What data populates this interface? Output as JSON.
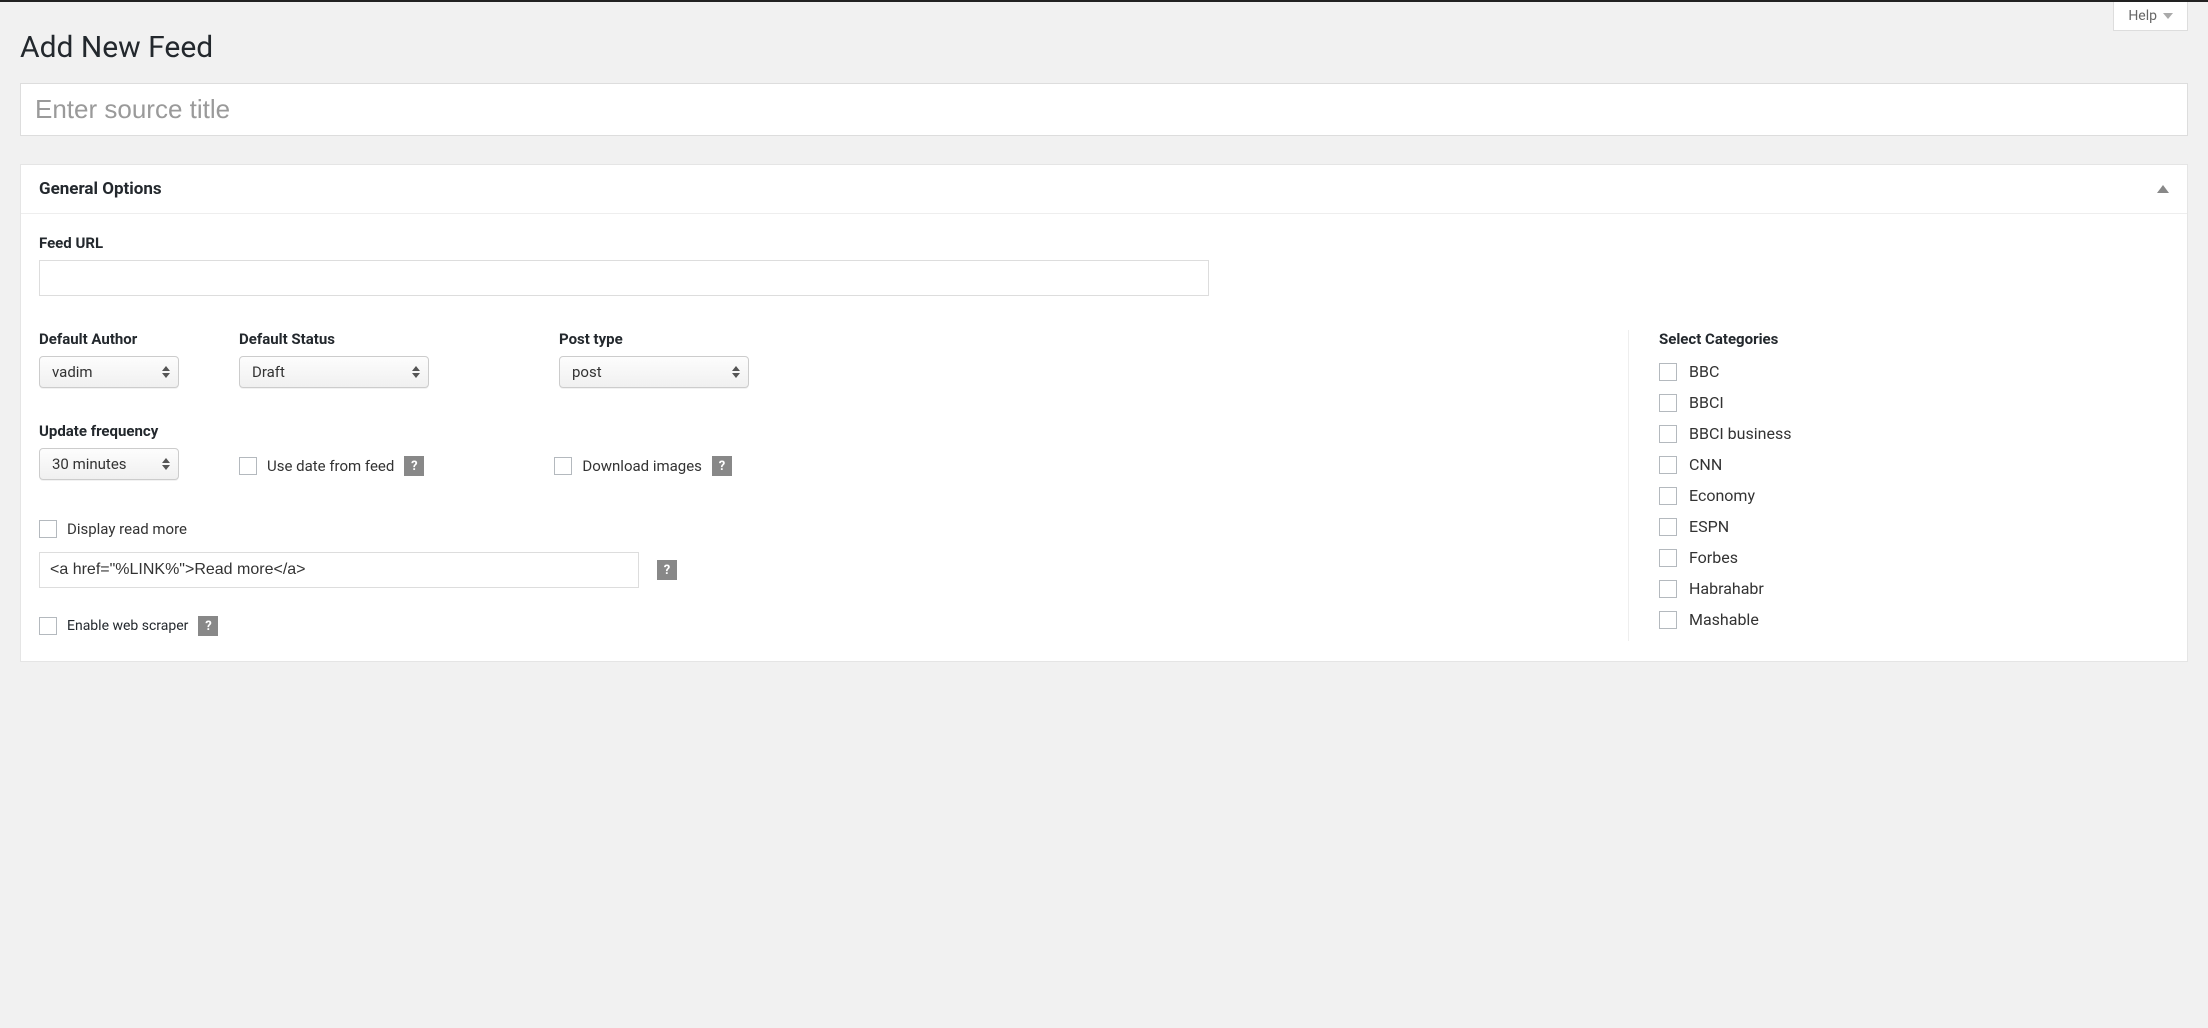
{
  "help": {
    "label": "Help"
  },
  "page": {
    "title": "Add New Feed"
  },
  "titleInput": {
    "placeholder": "Enter source title",
    "value": ""
  },
  "panel": {
    "title": "General Options"
  },
  "feedUrl": {
    "label": "Feed URL",
    "value": ""
  },
  "defaultAuthor": {
    "label": "Default Author",
    "value": "vadim"
  },
  "defaultStatus": {
    "label": "Default Status",
    "value": "Draft"
  },
  "postType": {
    "label": "Post type",
    "value": "post"
  },
  "updateFrequency": {
    "label": "Update frequency",
    "value": "30 minutes"
  },
  "useDateFromFeed": {
    "label": "Use date from feed"
  },
  "downloadImages": {
    "label": "Download images"
  },
  "displayReadMore": {
    "label": "Display read more"
  },
  "readMoreTemplate": {
    "value": "<a href=\"%LINK%\">Read more</a>"
  },
  "enableWebScraper": {
    "label": "Enable web scraper"
  },
  "helpBadge": {
    "text": "?"
  },
  "categoriesHeader": "Select Categories",
  "categories": [
    {
      "label": "BBC"
    },
    {
      "label": "BBCI"
    },
    {
      "label": "BBCI business"
    },
    {
      "label": "CNN"
    },
    {
      "label": "Economy"
    },
    {
      "label": "ESPN"
    },
    {
      "label": "Forbes"
    },
    {
      "label": "Habrahabr"
    },
    {
      "label": "Mashable"
    }
  ]
}
